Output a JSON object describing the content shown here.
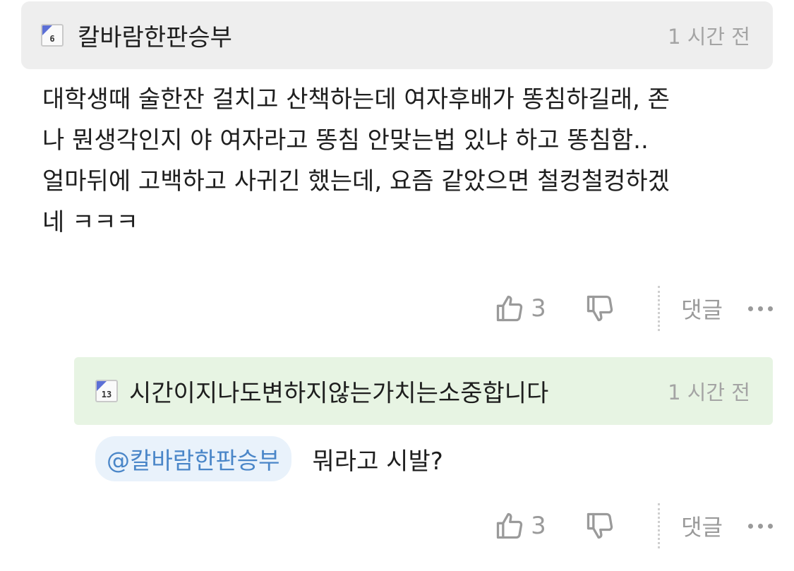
{
  "comment": {
    "level": "6",
    "author": "칼바람한판승부",
    "time": "1 시간 전",
    "lines": [
      "대학생때 술한잔 걸치고 산책하는데 여자후배가 똥침하길래, 존",
      "나 뭔생각인지 야 여자라고 똥침 안맞는법 있냐 하고 똥침함..",
      "얼마뒤에 고백하고 사귀긴 했는데, 요즘 같았으면 철컹철컹하겠",
      "네 ㅋㅋㅋ"
    ],
    "likes": "3",
    "reply_label": "댓글"
  },
  "reply": {
    "level": "13",
    "author": "시간이지나도변하지않는가치는소중합니다",
    "time": "1 시간 전",
    "mention": "@칼바람한판승부",
    "text": "뭐라고 시발?",
    "likes": "3",
    "reply_label": "댓글"
  },
  "icons": {
    "like": "thumbs-up-icon",
    "dislike": "thumbs-down-icon",
    "more": "more-horizontal-icon",
    "level": "level-badge-icon"
  },
  "colors": {
    "comment_header_bg": "#eeeeee",
    "reply_header_bg": "#e7f4e3",
    "mention_bg": "#e9f2fb",
    "mention_text": "#4a86c8",
    "muted": "#9a9a9a",
    "badge_corner": "#5b6fd6"
  }
}
